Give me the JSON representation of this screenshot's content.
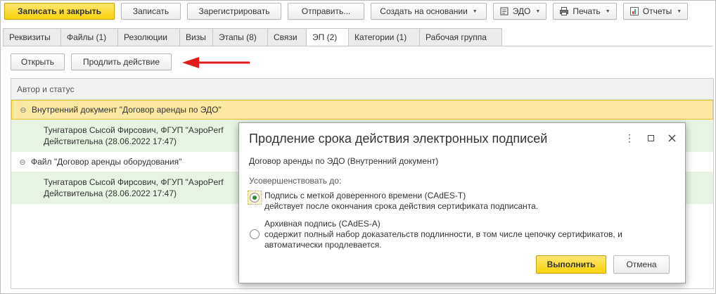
{
  "toolbar": {
    "save_close": "Записать и закрыть",
    "save": "Записать",
    "register": "Зарегистрировать",
    "send": "Отправить...",
    "create_based": "Создать на основании",
    "edo": "ЭДО",
    "print": "Печать",
    "reports": "Отчеты"
  },
  "tabs": [
    {
      "label": "Реквизиты"
    },
    {
      "label": "Файлы (1)"
    },
    {
      "label": "Резолюции"
    },
    {
      "label": "Визы"
    },
    {
      "label": "Этапы (8)"
    },
    {
      "label": "Связи"
    },
    {
      "label": "ЭП (2)"
    },
    {
      "label": "Категории (1)"
    },
    {
      "label": "Рабочая группа"
    }
  ],
  "actions": {
    "open": "Открыть",
    "extend": "Продлить действие"
  },
  "grid": {
    "header": "Автор и статус",
    "rows": [
      {
        "type": "group",
        "label": "Внутренний документ \"Договор аренды по ЭДО\""
      },
      {
        "type": "signature",
        "line1": "Тунгатаров Сысой Фирсович, ФГУП \"АэроPerf",
        "line2": "Действительна (28.06.2022 17:47)"
      },
      {
        "type": "group",
        "label": "Файл \"Договор аренды оборудования\""
      },
      {
        "type": "signature",
        "line1": "Тунгатаров Сысой Фирсович, ФГУП \"АэроPerf",
        "line2": "Действительна (28.06.2022 17:47)"
      }
    ]
  },
  "dialog": {
    "title": "Продление срока действия электронных подписей",
    "document": "Договор аренды по ЭДО (Внутренний документ)",
    "label": "Усовершенствовать до:",
    "options": [
      {
        "title": "Подпись с меткой доверенного времени (CAdES-T)",
        "desc1": "действует после окончания срока действия сертификата подписанта.",
        "desc2": "",
        "selected": true
      },
      {
        "title": "Архивная подпись (CAdES-A)",
        "desc1": "содержит полный набор доказательств подлинности, в том числе цепочку сертификатов, и",
        "desc2": "автоматически продлевается.",
        "selected": false
      }
    ],
    "execute": "Выполнить",
    "cancel": "Отмена"
  },
  "colors": {
    "primary_button": "#f9d20e",
    "selected_row": "#fbe9a3",
    "signature_row": "#e7f4e3",
    "arrow": "#e11b1b"
  }
}
